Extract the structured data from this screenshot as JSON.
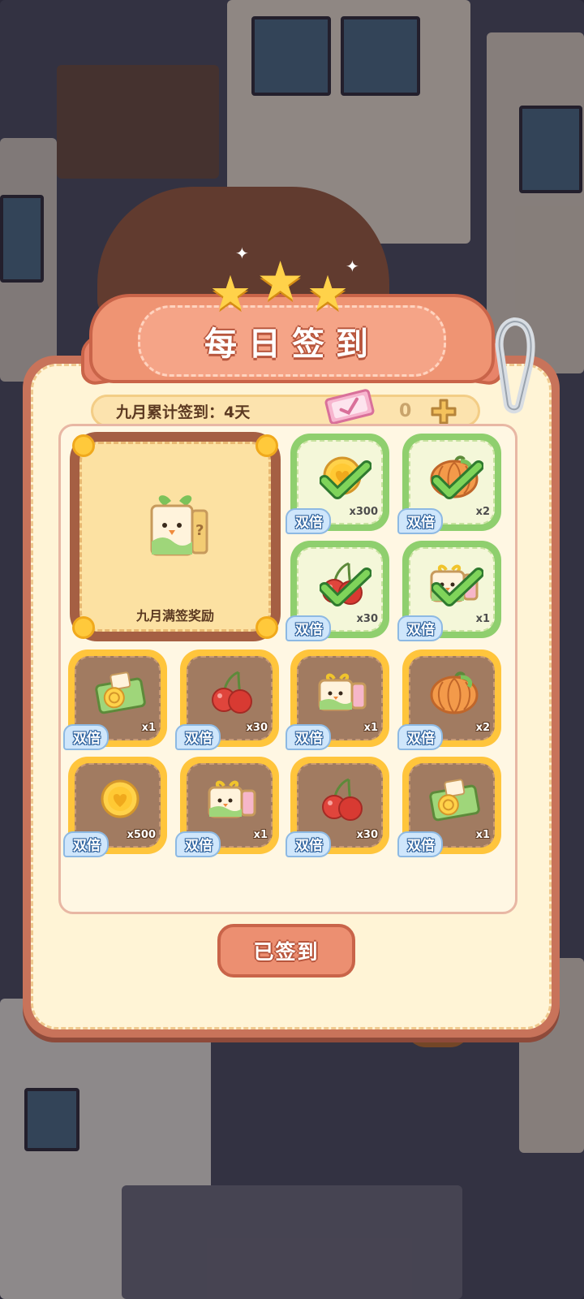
{
  "header": {
    "title": "每日签到"
  },
  "summary": {
    "month_label": "九月累计签到：4天",
    "ticket_count": "0"
  },
  "big_reward": {
    "label": "九月满签奖励"
  },
  "double_label": "双倍",
  "days": [
    {
      "item": "gold-coin",
      "qty": "x300",
      "claimed": true
    },
    {
      "item": "pumpkin",
      "qty": "x2",
      "claimed": true
    },
    {
      "item": "cherry",
      "qty": "x30",
      "claimed": true
    },
    {
      "item": "radish-bread",
      "qty": "x1",
      "claimed": true
    },
    {
      "item": "fruit-ticket",
      "qty": "x1",
      "claimed": false
    },
    {
      "item": "cherry",
      "qty": "x30",
      "claimed": false
    },
    {
      "item": "radish-bread",
      "qty": "x1",
      "claimed": false
    },
    {
      "item": "pumpkin",
      "qty": "x2",
      "claimed": false
    },
    {
      "item": "gold-coin",
      "qty": "x500",
      "claimed": false
    },
    {
      "item": "radish-bread",
      "qty": "x1",
      "claimed": false
    },
    {
      "item": "cherry",
      "qty": "x30",
      "claimed": false
    },
    {
      "item": "fruit-ticket",
      "qty": "x1",
      "claimed": false
    }
  ],
  "footer": {
    "signed_label": "已签到"
  },
  "colors": {
    "accent": "#ec8f71",
    "claimed_border": "#8fcf6e",
    "unclaimed_border": "#ffc53c"
  }
}
